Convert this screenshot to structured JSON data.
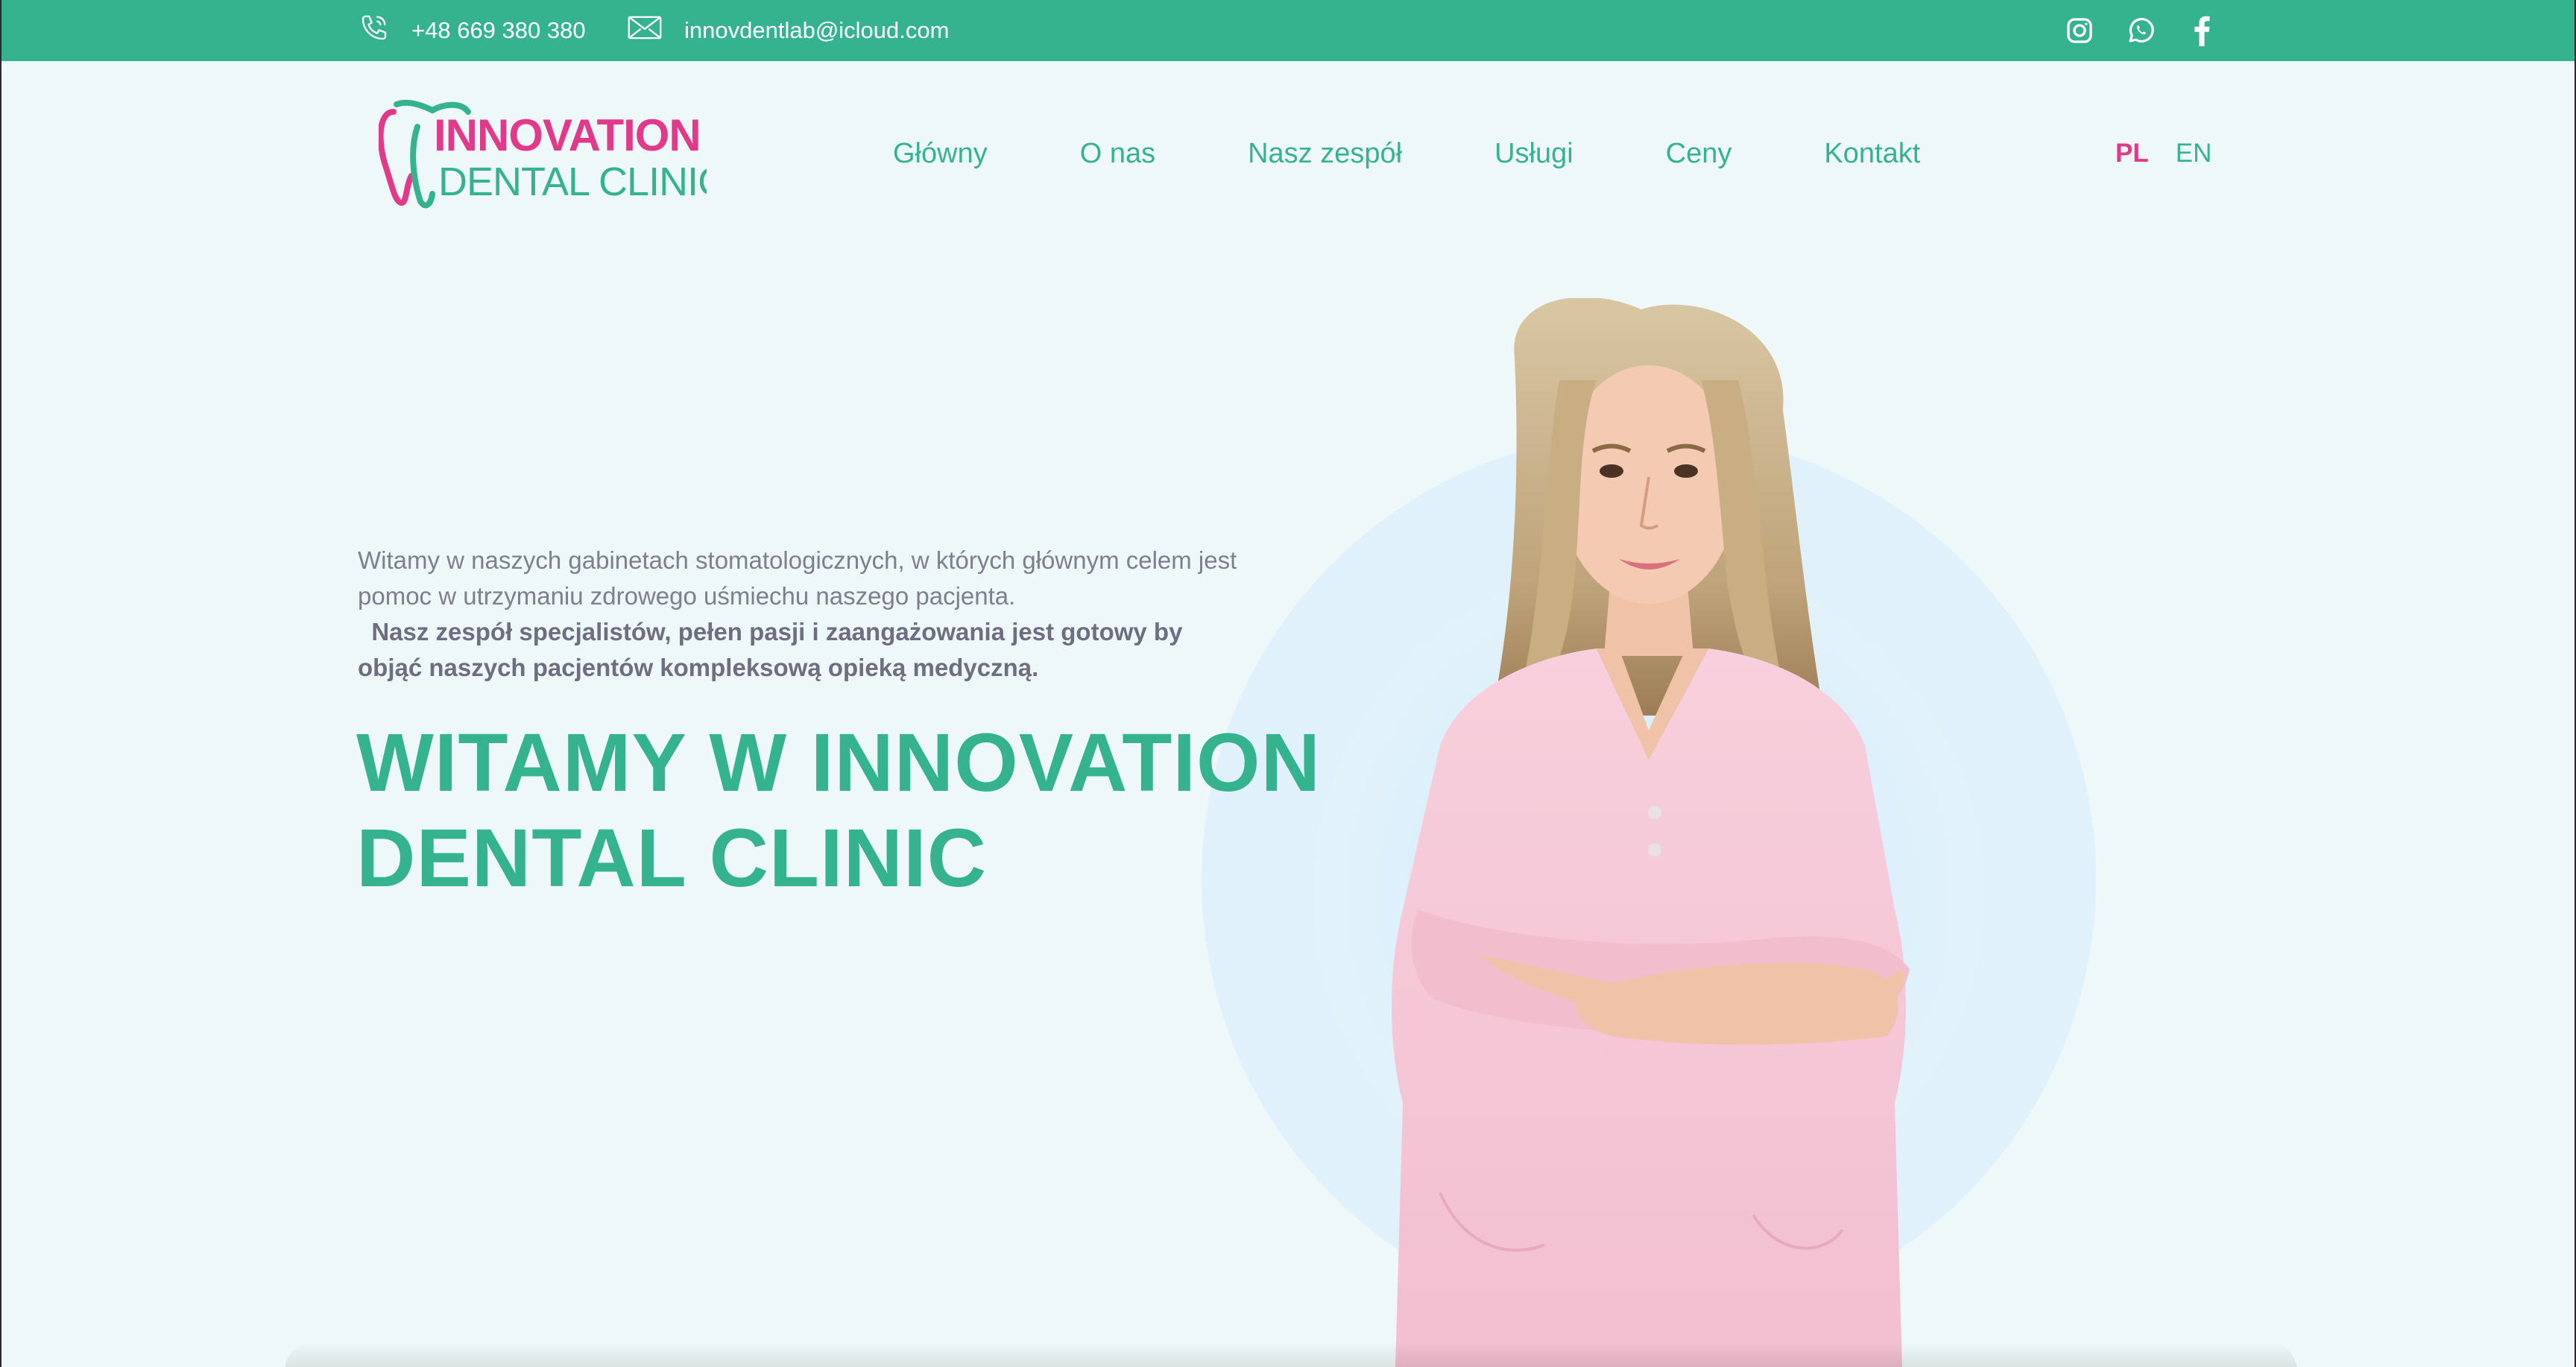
{
  "topbar": {
    "phone": "+48 669 380 380",
    "email": "innovdentlab@icloud.com",
    "phone_icon": "phone-icon",
    "email_icon": "envelope-icon",
    "socials": [
      "instagram-icon",
      "whatsapp-icon",
      "facebook-icon"
    ]
  },
  "logo": {
    "line1": "INNOVATION",
    "line2": "DENTAL CLINIC"
  },
  "nav": {
    "items": [
      {
        "label": "Główny"
      },
      {
        "label": "O nas"
      },
      {
        "label": "Nasz zespół"
      },
      {
        "label": "Usługi"
      },
      {
        "label": "Ceny"
      },
      {
        "label": "Kontakt"
      }
    ]
  },
  "lang": {
    "pl": "PL",
    "en": "EN"
  },
  "hero": {
    "intro_regular": "Witamy w naszych gabinetach stomatologicznych, w  których głównym celem jest pomoc w utrzymaniu zdrowego uśmiechu naszego pacjenta.",
    "intro_bold": "Nasz zespół specjalistów, pełen pasji i zaangażowania jest gotowy by objąć naszych pacjentów kompleksową opieką medyczną.",
    "headline": "WITAMY W INNOVATION DENTAL CLINIC"
  },
  "colors": {
    "accent": "#35b38f",
    "brand_pink": "#e23a8a",
    "page_bg": "#eff8f8"
  }
}
